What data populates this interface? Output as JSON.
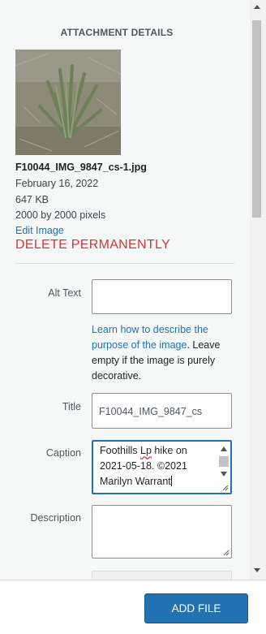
{
  "details": {
    "heading": "ATTACHMENT DETAILS",
    "filename": "F10044_IMG_9847_cs-1.jpg",
    "date": "February 16, 2022",
    "filesize": "647 KB",
    "dimensions": "2000 by 2000 pixels",
    "edit_label": "Edit Image",
    "delete_label": "DELETE PERMANENTLY"
  },
  "form": {
    "alt_label": "Alt Text",
    "alt_value": "",
    "help_link": "Learn how to describe the purpose of the image",
    "help_rest": ". Leave empty if the image is purely decorative.",
    "title_label": "Title",
    "title_value": "F10044_IMG_9847_cs",
    "caption_label": "Caption",
    "caption_spell": "Lp",
    "caption_a": "Foothills ",
    "caption_b": " hike on 2021-05-18. ©2021 Marilyn Warrant",
    "description_label": "Description",
    "description_value": ""
  },
  "footer": {
    "add_label": "ADD FILE"
  },
  "colors": {
    "accent": "#2271b1",
    "danger": "#d63638"
  },
  "icons": [
    "thumbnail-image",
    "resize-grip-icon",
    "scroll-up-arrow-icon",
    "scroll-down-arrow-icon"
  ]
}
